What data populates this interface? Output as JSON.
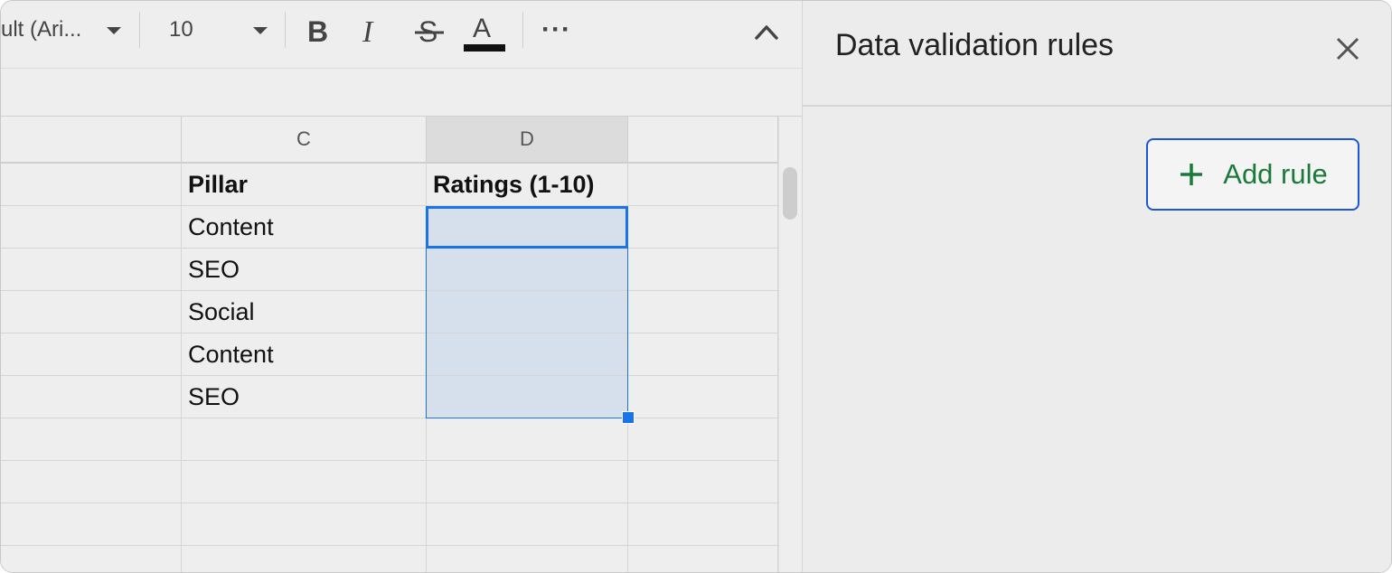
{
  "toolbar": {
    "font_name": "ult (Ari...",
    "font_size": "10",
    "more_label": "···"
  },
  "grid": {
    "columns": [
      "C",
      "D"
    ],
    "rows": [
      {
        "c": "Pillar",
        "d": "Ratings (1-10)"
      },
      {
        "c": "Content",
        "d": ""
      },
      {
        "c": "SEO",
        "d": ""
      },
      {
        "c": "Social",
        "d": ""
      },
      {
        "c": "Content",
        "d": ""
      },
      {
        "c": "SEO",
        "d": ""
      },
      {
        "c": "",
        "d": ""
      },
      {
        "c": "",
        "d": ""
      },
      {
        "c": "",
        "d": ""
      },
      {
        "c": "",
        "d": ""
      }
    ]
  },
  "panel": {
    "title": "Data validation rules",
    "add_rule_label": "Add rule"
  },
  "icons": [
    "chevron-down-icon",
    "bold-icon",
    "italic-icon",
    "strikethrough-icon",
    "text-color-icon",
    "more-icon",
    "collapse-icon",
    "close-icon",
    "plus-icon"
  ],
  "colors": {
    "selection_border": "#1a73e8",
    "selection_fill": "#d6e0ec",
    "add_rule_text": "#1b7a3a",
    "add_rule_border": "#1a57d6"
  }
}
